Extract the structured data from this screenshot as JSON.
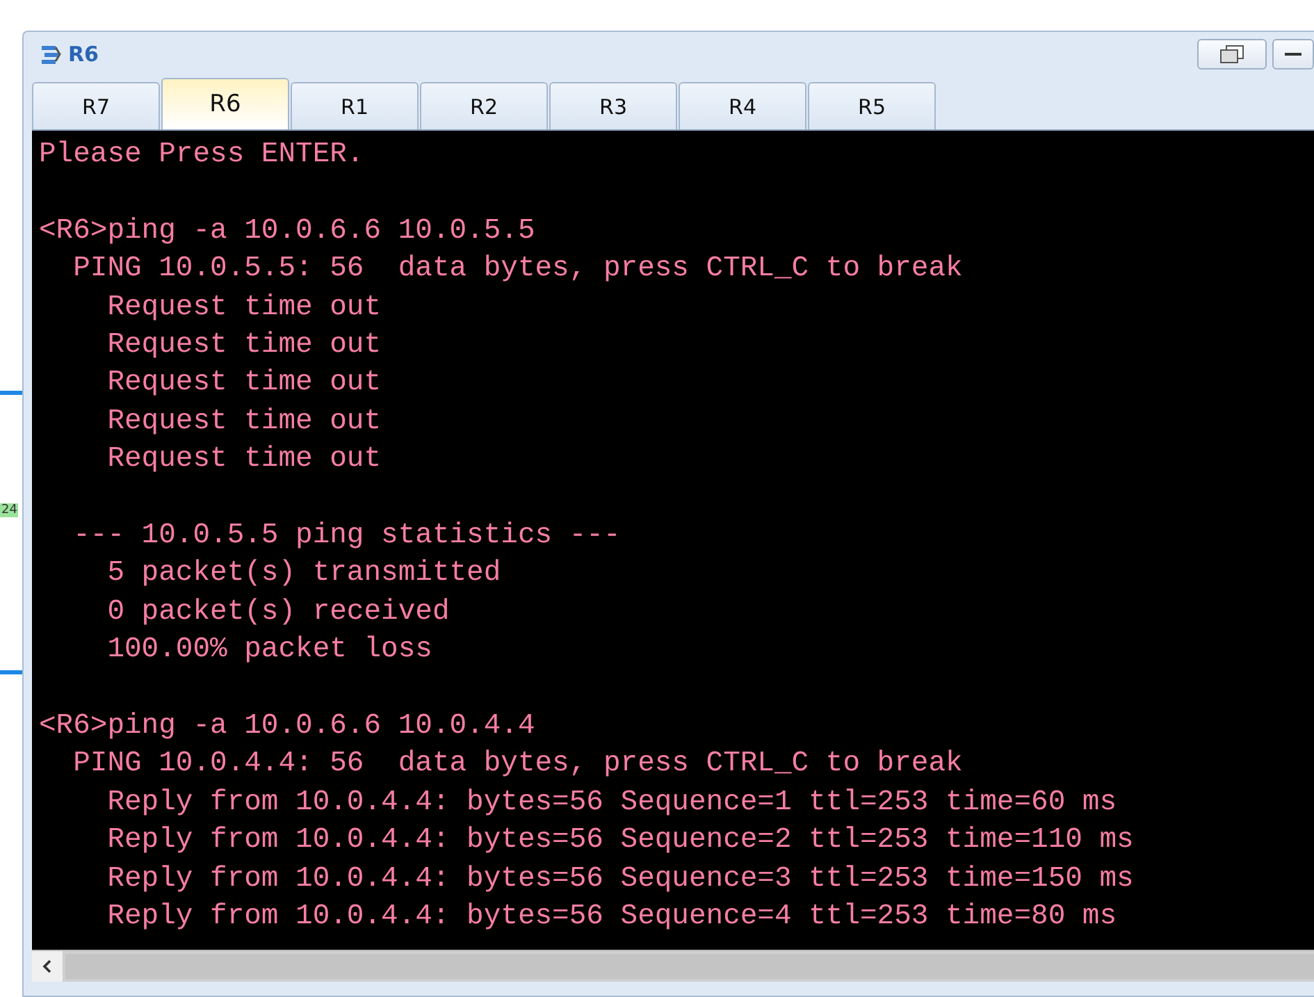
{
  "backdrop": {
    "label": "24"
  },
  "window": {
    "title": "R6"
  },
  "tabs": [
    {
      "label": "R7",
      "selected": false
    },
    {
      "label": "R6",
      "selected": true
    },
    {
      "label": "R1",
      "selected": false
    },
    {
      "label": "R2",
      "selected": false
    },
    {
      "label": "R3",
      "selected": false
    },
    {
      "label": "R4",
      "selected": false
    },
    {
      "label": "R5",
      "selected": false
    }
  ],
  "terminal": {
    "blocks": [
      [
        "Please Press ENTER."
      ],
      [
        "<R6>ping -a 10.0.6.6 10.0.5.5",
        "  PING 10.0.5.5: 56  data bytes, press CTRL_C to break",
        "    Request time out",
        "    Request time out",
        "    Request time out",
        "    Request time out",
        "    Request time out"
      ],
      [
        "  --- 10.0.5.5 ping statistics ---",
        "    5 packet(s) transmitted",
        "    0 packet(s) received",
        "    100.00% packet loss"
      ],
      [
        "<R6>ping -a 10.0.6.6 10.0.4.4",
        "  PING 10.0.4.4: 56  data bytes, press CTRL_C to break",
        "    Reply from 10.0.4.4: bytes=56 Sequence=1 ttl=253 time=60 ms",
        "    Reply from 10.0.4.4: bytes=56 Sequence=2 ttl=253 time=110 ms",
        "    Reply from 10.0.4.4: bytes=56 Sequence=3 ttl=253 time=150 ms",
        "    Reply from 10.0.4.4: bytes=56 Sequence=4 ttl=253 time=80 ms"
      ]
    ]
  }
}
